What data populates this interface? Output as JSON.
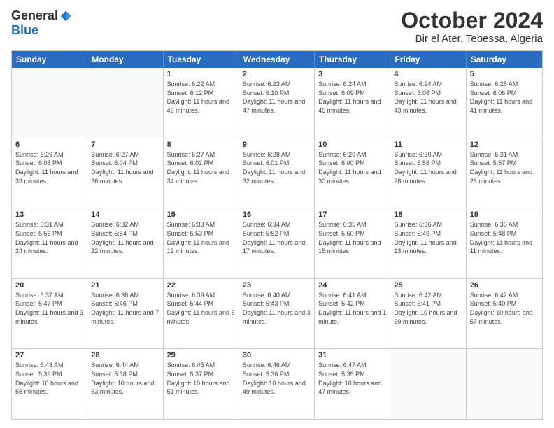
{
  "logo": {
    "general": "General",
    "blue": "Blue"
  },
  "header": {
    "month": "October 2024",
    "location": "Bir el Ater, Tebessa, Algeria"
  },
  "weekdays": [
    "Sunday",
    "Monday",
    "Tuesday",
    "Wednesday",
    "Thursday",
    "Friday",
    "Saturday"
  ],
  "weeks": [
    [
      {
        "day": "",
        "info": ""
      },
      {
        "day": "",
        "info": ""
      },
      {
        "day": "1",
        "info": "Sunrise: 6:22 AM\nSunset: 6:12 PM\nDaylight: 11 hours and 49 minutes."
      },
      {
        "day": "2",
        "info": "Sunrise: 6:23 AM\nSunset: 6:10 PM\nDaylight: 11 hours and 47 minutes."
      },
      {
        "day": "3",
        "info": "Sunrise: 6:24 AM\nSunset: 6:09 PM\nDaylight: 11 hours and 45 minutes."
      },
      {
        "day": "4",
        "info": "Sunrise: 6:24 AM\nSunset: 6:08 PM\nDaylight: 11 hours and 43 minutes."
      },
      {
        "day": "5",
        "info": "Sunrise: 6:25 AM\nSunset: 6:06 PM\nDaylight: 11 hours and 41 minutes."
      }
    ],
    [
      {
        "day": "6",
        "info": "Sunrise: 6:26 AM\nSunset: 6:05 PM\nDaylight: 11 hours and 39 minutes."
      },
      {
        "day": "7",
        "info": "Sunrise: 6:27 AM\nSunset: 6:04 PM\nDaylight: 11 hours and 36 minutes."
      },
      {
        "day": "8",
        "info": "Sunrise: 6:27 AM\nSunset: 6:02 PM\nDaylight: 11 hours and 34 minutes."
      },
      {
        "day": "9",
        "info": "Sunrise: 6:28 AM\nSunset: 6:01 PM\nDaylight: 11 hours and 32 minutes."
      },
      {
        "day": "10",
        "info": "Sunrise: 6:29 AM\nSunset: 6:00 PM\nDaylight: 11 hours and 30 minutes."
      },
      {
        "day": "11",
        "info": "Sunrise: 6:30 AM\nSunset: 5:58 PM\nDaylight: 11 hours and 28 minutes."
      },
      {
        "day": "12",
        "info": "Sunrise: 6:31 AM\nSunset: 5:57 PM\nDaylight: 11 hours and 26 minutes."
      }
    ],
    [
      {
        "day": "13",
        "info": "Sunrise: 6:31 AM\nSunset: 5:56 PM\nDaylight: 11 hours and 24 minutes."
      },
      {
        "day": "14",
        "info": "Sunrise: 6:32 AM\nSunset: 5:54 PM\nDaylight: 11 hours and 22 minutes."
      },
      {
        "day": "15",
        "info": "Sunrise: 6:33 AM\nSunset: 5:53 PM\nDaylight: 11 hours and 19 minutes."
      },
      {
        "day": "16",
        "info": "Sunrise: 6:34 AM\nSunset: 5:52 PM\nDaylight: 11 hours and 17 minutes."
      },
      {
        "day": "17",
        "info": "Sunrise: 6:35 AM\nSunset: 5:50 PM\nDaylight: 11 hours and 15 minutes."
      },
      {
        "day": "18",
        "info": "Sunrise: 6:36 AM\nSunset: 5:49 PM\nDaylight: 11 hours and 13 minutes."
      },
      {
        "day": "19",
        "info": "Sunrise: 6:36 AM\nSunset: 5:48 PM\nDaylight: 11 hours and 11 minutes."
      }
    ],
    [
      {
        "day": "20",
        "info": "Sunrise: 6:37 AM\nSunset: 5:47 PM\nDaylight: 11 hours and 9 minutes."
      },
      {
        "day": "21",
        "info": "Sunrise: 6:38 AM\nSunset: 5:46 PM\nDaylight: 11 hours and 7 minutes."
      },
      {
        "day": "22",
        "info": "Sunrise: 6:39 AM\nSunset: 5:44 PM\nDaylight: 11 hours and 5 minutes."
      },
      {
        "day": "23",
        "info": "Sunrise: 6:40 AM\nSunset: 5:43 PM\nDaylight: 11 hours and 3 minutes."
      },
      {
        "day": "24",
        "info": "Sunrise: 6:41 AM\nSunset: 5:42 PM\nDaylight: 11 hours and 1 minute."
      },
      {
        "day": "25",
        "info": "Sunrise: 6:42 AM\nSunset: 5:41 PM\nDaylight: 10 hours and 59 minutes."
      },
      {
        "day": "26",
        "info": "Sunrise: 6:42 AM\nSunset: 5:40 PM\nDaylight: 10 hours and 57 minutes."
      }
    ],
    [
      {
        "day": "27",
        "info": "Sunrise: 6:43 AM\nSunset: 5:39 PM\nDaylight: 10 hours and 55 minutes."
      },
      {
        "day": "28",
        "info": "Sunrise: 6:44 AM\nSunset: 5:38 PM\nDaylight: 10 hours and 53 minutes."
      },
      {
        "day": "29",
        "info": "Sunrise: 6:45 AM\nSunset: 5:37 PM\nDaylight: 10 hours and 51 minutes."
      },
      {
        "day": "30",
        "info": "Sunrise: 6:46 AM\nSunset: 5:36 PM\nDaylight: 10 hours and 49 minutes."
      },
      {
        "day": "31",
        "info": "Sunrise: 6:47 AM\nSunset: 5:35 PM\nDaylight: 10 hours and 47 minutes."
      },
      {
        "day": "",
        "info": ""
      },
      {
        "day": "",
        "info": ""
      }
    ]
  ]
}
